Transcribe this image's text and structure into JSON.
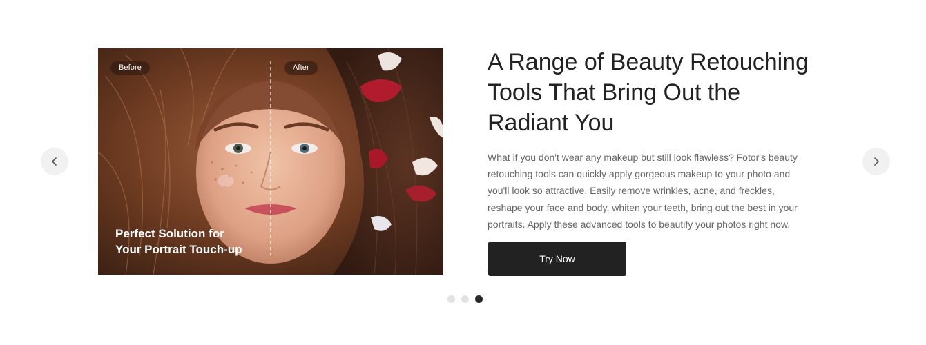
{
  "carousel": {
    "prev_icon": "chevron-left-icon",
    "next_icon": "chevron-right-icon",
    "slides_total": 3,
    "active_slide": 3
  },
  "photo": {
    "before_label": "Before",
    "after_label": "After",
    "caption_line1": "Perfect Solution for",
    "caption_line2": "Your Portrait Touch-up"
  },
  "content": {
    "title_line1": "A Range of Beauty Retouching",
    "title_line2": "Tools That Bring Out the",
    "title_line3": "Radiant You",
    "body_lines": [
      "What if you don't wear any makeup but still look flawless? Fotor's beauty",
      "retouching tools can quickly apply gorgeous makeup to your photo and",
      "you'll look so attractive. Easily remove wrinkles, acne, and freckles,",
      "reshape your face and body, whiten your teeth, bring out the best in your",
      "portraits. Apply these advanced tools to beautify your photos right now."
    ],
    "cta_label": "Try Now"
  },
  "colors": {
    "title": "#222222",
    "body": "#666666",
    "cta_bg": "#222222",
    "arrow_bg": "#f1f1f1",
    "dot_inactive": "#e2e2e2",
    "dot_active": "#2a2a2a"
  }
}
